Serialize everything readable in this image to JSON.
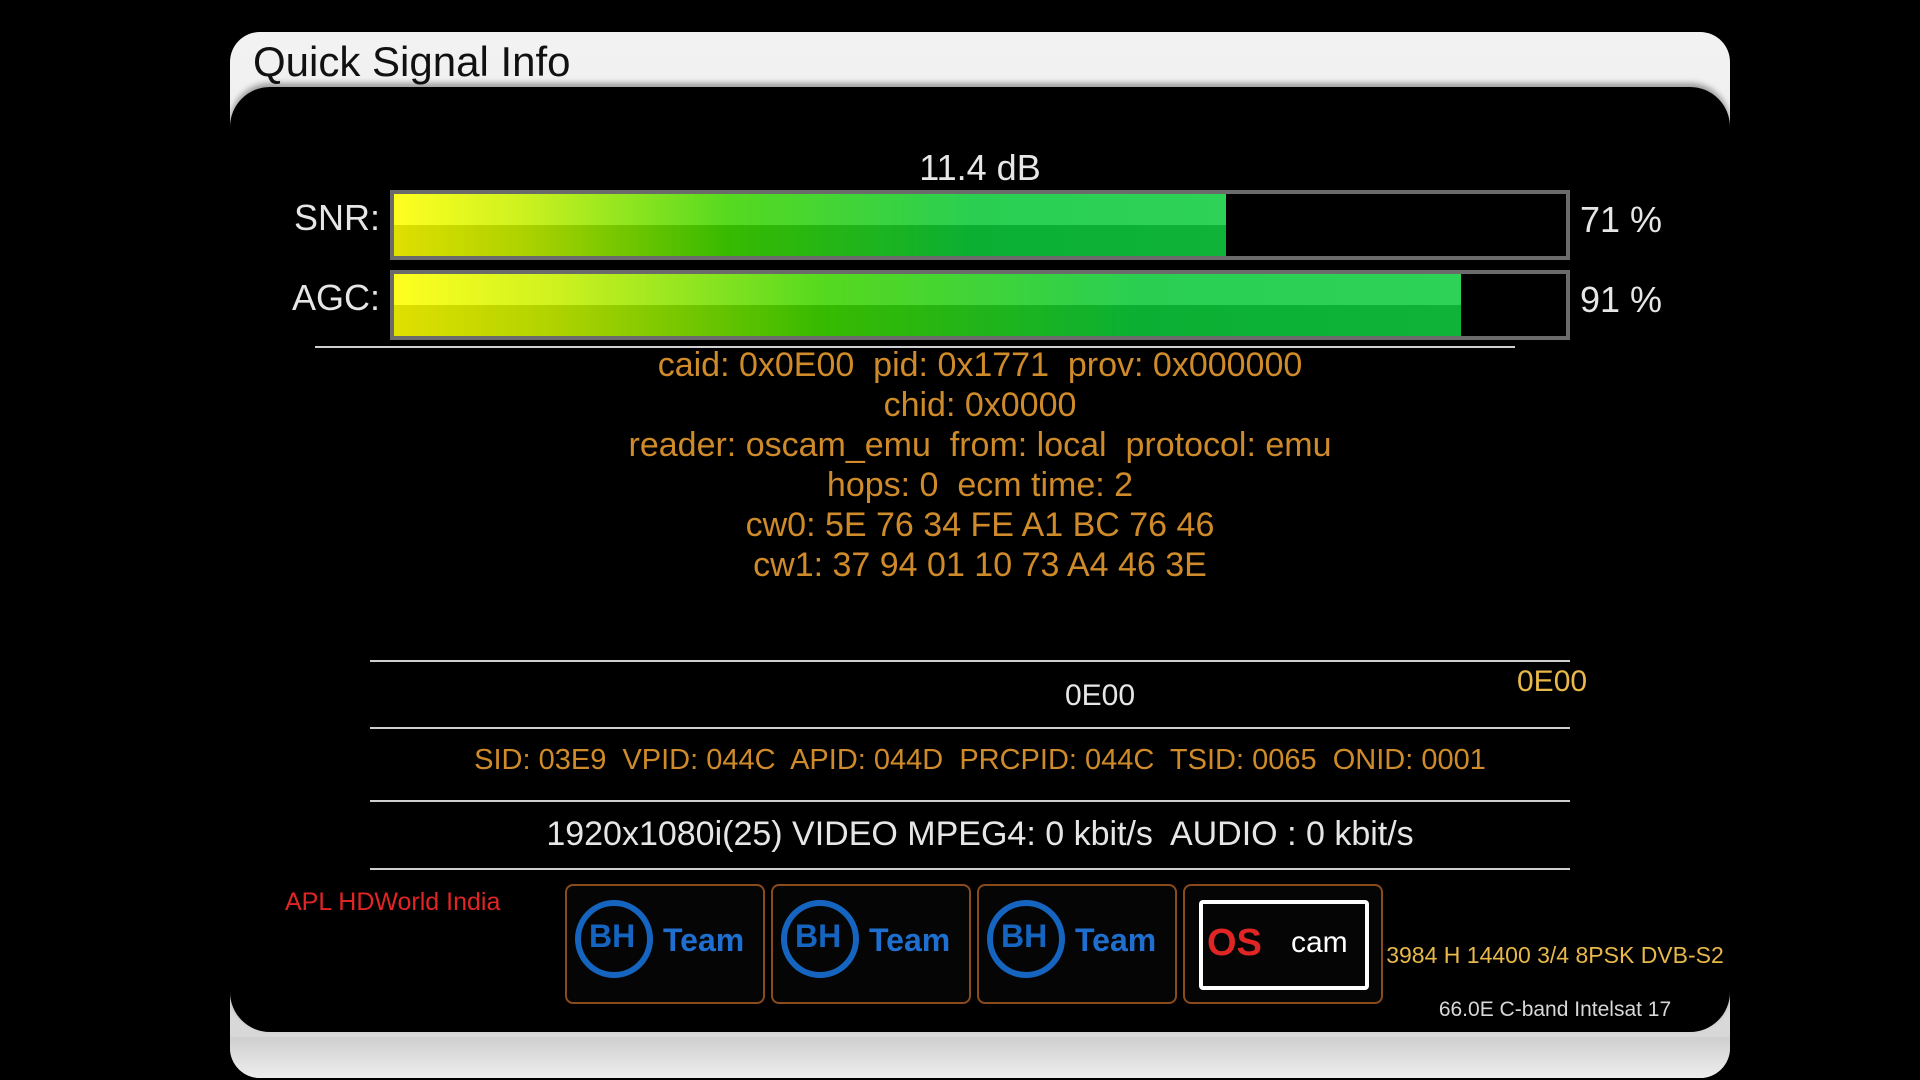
{
  "window": {
    "title": "Quick Signal Info"
  },
  "signal": {
    "snr_db": "11.4 dB",
    "snr": {
      "label": "SNR:",
      "percent_text": "71 %",
      "level": 71
    },
    "agc": {
      "label": "AGC:",
      "percent_text": "91 %",
      "level": 91
    }
  },
  "cam_info": {
    "lines": [
      "caid: 0x0E00  pid: 0x1771  prov: 0x000000",
      "chid: 0x0000",
      "reader: oscam_emu  from: local  protocol: emu",
      "hops: 0  ecm time: 2",
      "cw0: 5E 76 34 FE A1 BC 76 46",
      "cw1: 37 94 01 10 73 A4 46 3E"
    ]
  },
  "caid_center": "0E00",
  "caid_right": "0E00",
  "pids": "SID: 03E9  VPID: 044C  APID: 044D  PRCPID: 044C  TSID: 0065  ONID: 0001",
  "video_info": "1920x1080i(25) VIDEO MPEG4: 0 kbit/s  AUDIO : 0 kbit/s",
  "channel_name": "APL HDWorld India",
  "logos": [
    {
      "bh": "BH",
      "team": "Team"
    },
    {
      "bh": "BH",
      "team": "Team"
    },
    {
      "bh": "BH",
      "team": "Team"
    }
  ],
  "oscam_logo": {
    "os": "OS",
    "cam": "cam"
  },
  "transponder": {
    "line1": "3984 H 14400 3/4 8PSK DVB-S2",
    "line2": "66.0E C-band Intelsat 17"
  },
  "colors": {
    "accent_orange": "#cf8b2a",
    "accent_yellow": "#e8b84a",
    "channel_red": "#e02525",
    "logo_blue": "#1565c0"
  }
}
